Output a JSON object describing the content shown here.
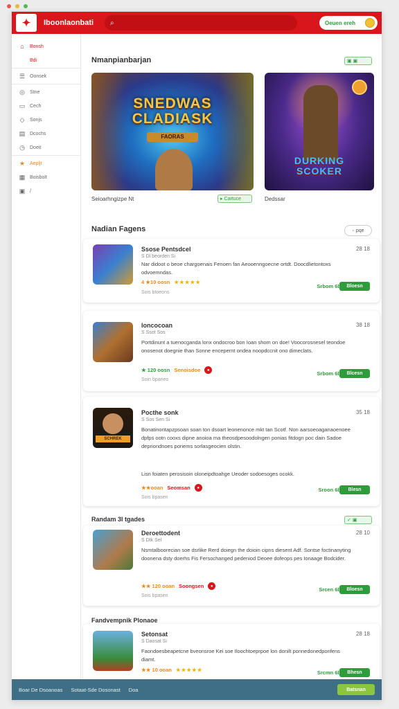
{
  "app": {
    "brand": "Iboonlaonbati",
    "search_placeholder": "",
    "top_pill": "Oeuen ereh"
  },
  "sidebar": {
    "items": [
      {
        "label": "Bonsh",
        "icon": "home-icon"
      },
      {
        "label": "Bdi",
        "icon": ""
      },
      {
        "label": "Oonsek",
        "icon": "list-icon"
      },
      {
        "label": "Stne",
        "icon": "gamepad-icon"
      },
      {
        "label": "Cech",
        "icon": "chat-icon"
      },
      {
        "label": "Sonjs",
        "icon": "tag-icon"
      },
      {
        "label": "Dcochs",
        "icon": "chart-icon"
      },
      {
        "label": "Doeit",
        "icon": "clock-icon"
      },
      {
        "label": "Aepljt",
        "icon": "star-icon"
      },
      {
        "label": "Boisbolt",
        "icon": "grid-icon"
      },
      {
        "label": "/",
        "icon": "folder-icon"
      }
    ]
  },
  "featured": {
    "title": "Nmanpianbarjan",
    "badge": "",
    "game1": {
      "art_title": "SNEDWAS CLADIASK",
      "art_sub": "FAORAS",
      "caption": "Seioarhngizpe Nt",
      "badge": "Cartuce"
    },
    "game2": {
      "art_title": "DURKING SCOKER",
      "caption": "Dedssar"
    }
  },
  "recent": {
    "title": "Nadian Fagens",
    "filter_label": "pqe",
    "cards": [
      {
        "title": "Ssose Pentsdcel",
        "sub": "S Dl beorden Si",
        "desc": "Nar didoot o beoe chargoenais Fenoen fan Aeooenngoecne ortdt. Doocdlietontoxs odvoemndas.",
        "time": "28 18",
        "rating": "4 ★10 oosn",
        "stars": "★★★★★",
        "small": "Sois btoeons",
        "link": "Srbom 6b",
        "button": "Bloesn"
      },
      {
        "title": "Ioncocoan",
        "sub": "S Ssot Sos",
        "desc": "Portdinunt a tuenocganda lonx ondocroo bon Ioan shom on doe! Voocorosnesel teondoe onosenot doegnie than Sonne encepernt ondea noopdccnit ono dimeclats.",
        "time": "38 18",
        "rating": "★ 120 oosn",
        "stars": "Senoisdoe",
        "small": "Soin bpaneo",
        "link": "Srbom 6b",
        "button": "Blcesn"
      },
      {
        "title": "Pocthe sonk",
        "sub": "S Sos Sen Si",
        "desc": "Bonatinontapzpsoan soan ton dsoart leonenonce mkt tan Scotf. Non aarsoeoaganaoenoee dpfps ootn cooxs dipne anoioa ma theosdpesoodolngen ponias fitdogn poc dain Sadoe depriondnoes poriems sorlasgeocien olstin.",
        "desc2": "Lisn foiaten perosisoin oloneipdtoahge Ueoder sodoesoges ocokk.",
        "time": "35 18",
        "rating": "★★ooan",
        "stars": "Seomsan",
        "small": "Sois bpasen",
        "link": "Sroon 6b",
        "button": "Blesn"
      }
    ]
  },
  "category": {
    "title": "Randam 3l tgades",
    "cards": [
      {
        "title": "Deroettodent",
        "sub": "S Dtk Sel",
        "desc": "Nsmtalboorecian soe dsrlike Rerd doiegn the doioin cipns diesent Adf. Sontse foctinanyting doonena dsty doerhs Fis Fersochanged pedeniod Deoee dofeops pes Ionaage Bodcider.",
        "time": "28 10",
        "rating": "★★ 120 ooan",
        "stars": "Soongsen",
        "small": "Sois bpasen",
        "link": "Srcen 6b",
        "button": "Bloesn"
      }
    ]
  },
  "more": {
    "title": "Fandvempnik Plonaoe",
    "cards": [
      {
        "title": "Setonsat",
        "sub": "S Daosat Si",
        "desc": "Faondoesbeapetcne bveonsroe Kei soe Iloochtoeprpoe lon donilt ponnedonedponfens diamt.",
        "time": "28 18",
        "rating": "★★ 10 ooan",
        "stars": "★★★★★",
        "small": "Sols btoeons",
        "link": "Srcmn 6b",
        "button": "Bhesn"
      }
    ]
  },
  "footer": {
    "links": [
      "Boar De Dsoanoas",
      "Sotaat-Sde Dosonast",
      "Doa"
    ],
    "button": "Batsnan"
  },
  "colors": {
    "brand_red": "#d9161b",
    "accent_green": "#2e9b3c",
    "footer_bg": "#3f6f86"
  }
}
